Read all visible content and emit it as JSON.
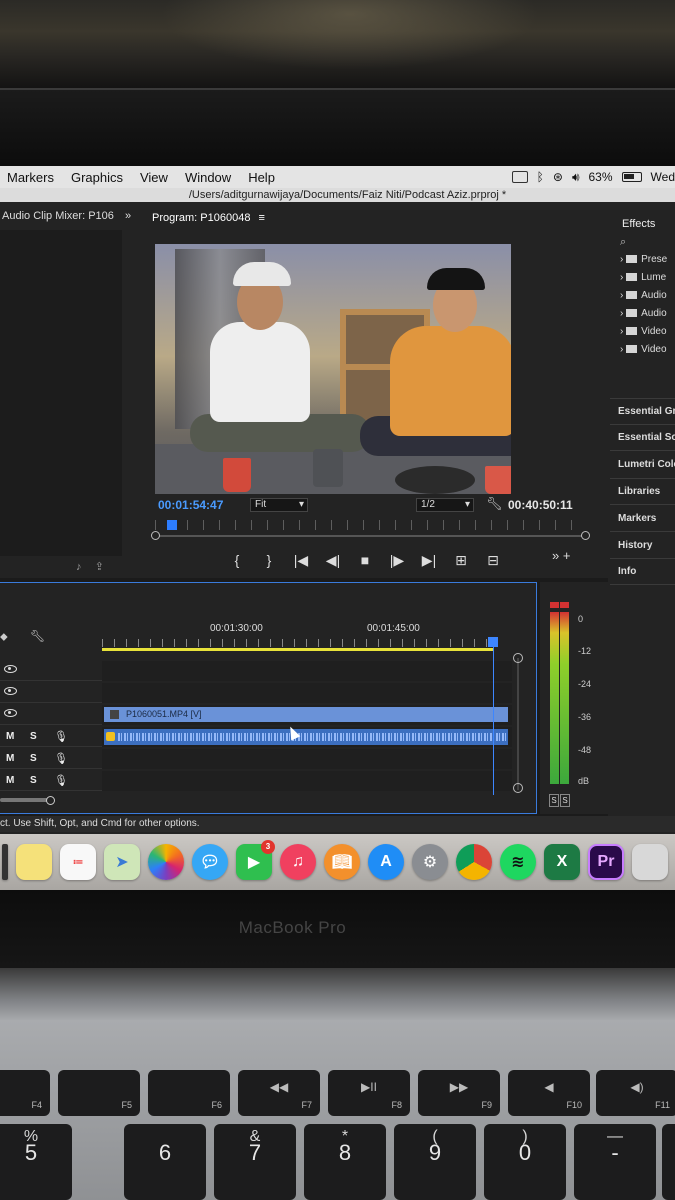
{
  "menubar": {
    "items": [
      "Markers",
      "Graphics",
      "View",
      "Window",
      "Help"
    ],
    "battery": "63%",
    "day": "Wed"
  },
  "project_path": "/Users/aditgurnawijaya/Documents/Faiz Niti/Podcast Aziz.prproj *",
  "audio_clip_mixer": {
    "title": "Audio Clip Mixer: P106"
  },
  "program_monitor": {
    "title": "Program: P1060048",
    "current_time": "00:01:54:47",
    "zoom": "Fit",
    "resolution": "1/2",
    "duration": "00:40:50:11"
  },
  "effects_panel": {
    "title": "Effects",
    "items": [
      "Prese",
      "Lume",
      "Audio",
      "Audio",
      "Video",
      "Video"
    ],
    "sections": [
      "Essential Gra",
      "Essential Sou",
      "Lumetri Colo",
      "Libraries",
      "Markers",
      "History",
      "Info"
    ]
  },
  "timeline": {
    "ruler": [
      "00:01:30:00",
      "00:01:45:00"
    ],
    "clip_video": "P1060051.MP4 [V]",
    "audio_track_labels": {
      "mute": "M",
      "solo": "S"
    }
  },
  "meters": {
    "db_labels": [
      "0",
      "-12",
      "-24",
      "-36",
      "-48",
      "dB"
    ],
    "solo_labels": [
      "S",
      "S"
    ]
  },
  "statusbar": "ct. Use Shift, Opt, and Cmd for other options.",
  "dock": {
    "facetime_badge": "3",
    "excel_label": "X",
    "premiere_label": "Pr",
    "colors": {
      "notes": "#f5e17a",
      "photos": "#f0f0f0",
      "messages": "#35a7f5",
      "facetime": "#2fbf4f",
      "music": "#f0405f",
      "books": "#f3902c",
      "appstore": "#1f8df6",
      "prefs": "#8a8d92",
      "chrome": "#e8e8e8",
      "spotify": "#1ed760",
      "excel": "#1d7a44",
      "premiere": "#2a0a4a"
    }
  },
  "laptop": {
    "brand": "MacBook Pro",
    "keys_fn": [
      {
        "label": "F4"
      },
      {
        "label": "F5"
      },
      {
        "label": "F6"
      },
      {
        "label": "F7",
        "icon": "◀◀"
      },
      {
        "label": "F8",
        "icon": "▶II"
      },
      {
        "label": "F9",
        "icon": "▶▶"
      },
      {
        "label": "F10",
        "icon": "◀"
      },
      {
        "label": "F11",
        "icon": "◀)"
      }
    ],
    "keys_num": [
      {
        "up": "%",
        "main": "5"
      },
      {
        "up": "",
        "main": "6"
      },
      {
        "up": "&",
        "main": "7"
      },
      {
        "up": "*",
        "main": "8"
      },
      {
        "up": "(",
        "main": "9"
      },
      {
        "up": ")",
        "main": "0"
      },
      {
        "up": "—",
        "main": "-"
      },
      {
        "up": "",
        "main": ""
      }
    ]
  }
}
